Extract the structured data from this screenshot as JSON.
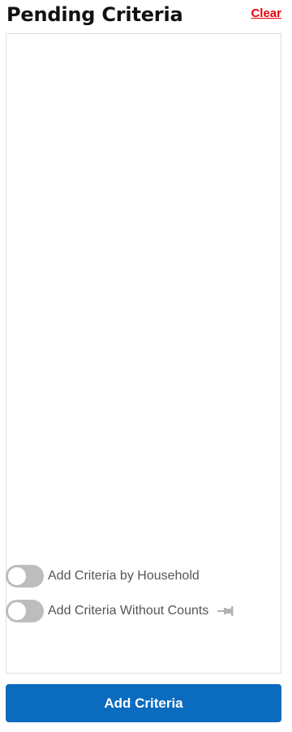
{
  "header": {
    "title": "Pending Criteria",
    "clear_label": "Clear"
  },
  "colors": {
    "clear_link": "#e8000b",
    "primary_button": "#0b6bbf",
    "toggle_off": "#bdbdbd",
    "panel_border": "#dddddd"
  },
  "toggles": [
    {
      "label": "Add Criteria by Household",
      "state": "off"
    },
    {
      "label": "Add Criteria Without Counts",
      "state": "off",
      "trailing_icon": "pin-icon"
    }
  ],
  "footer": {
    "add_label": "Add Criteria"
  }
}
